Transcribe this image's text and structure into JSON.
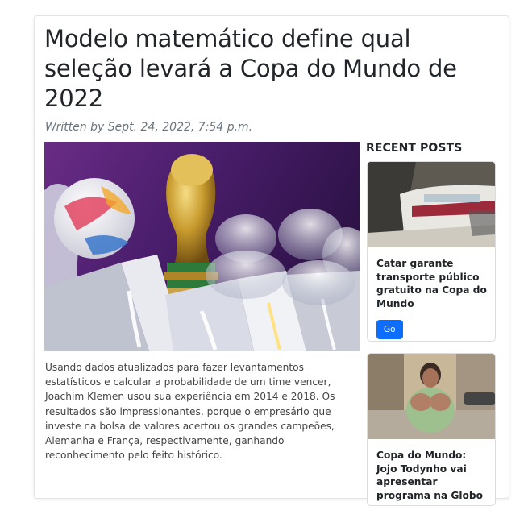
{
  "article": {
    "title": "Modelo matemático define qual seleção levará a Copa do Mundo de 2022",
    "meta": "Written by Sept. 24, 2022, 7:54 p.m.",
    "body": "Usando dados atualizados para fazer levantamentos estatísticos e calcular a probabilidade de um time vencer, Joachim Klemen usou sua experiência em 2014 e 2018. Os resultados são impressionantes, porque o empresário que investe na bolsa de valores acertou os grandes campeões, Alemanha e França, respectivamente, ganhando reconhecimento pelo feito histórico."
  },
  "sidebar": {
    "heading": "RECENT POSTS",
    "posts": [
      {
        "title": "Catar garante transporte público gratuito na Copa do Mundo",
        "button": "Go"
      },
      {
        "title": "Copa do Mundo: Jojo Todynho vai apresentar programa na Globo"
      }
    ]
  },
  "colors": {
    "text": "#212529",
    "muted": "#6c757d",
    "button": "#0d6efd"
  }
}
